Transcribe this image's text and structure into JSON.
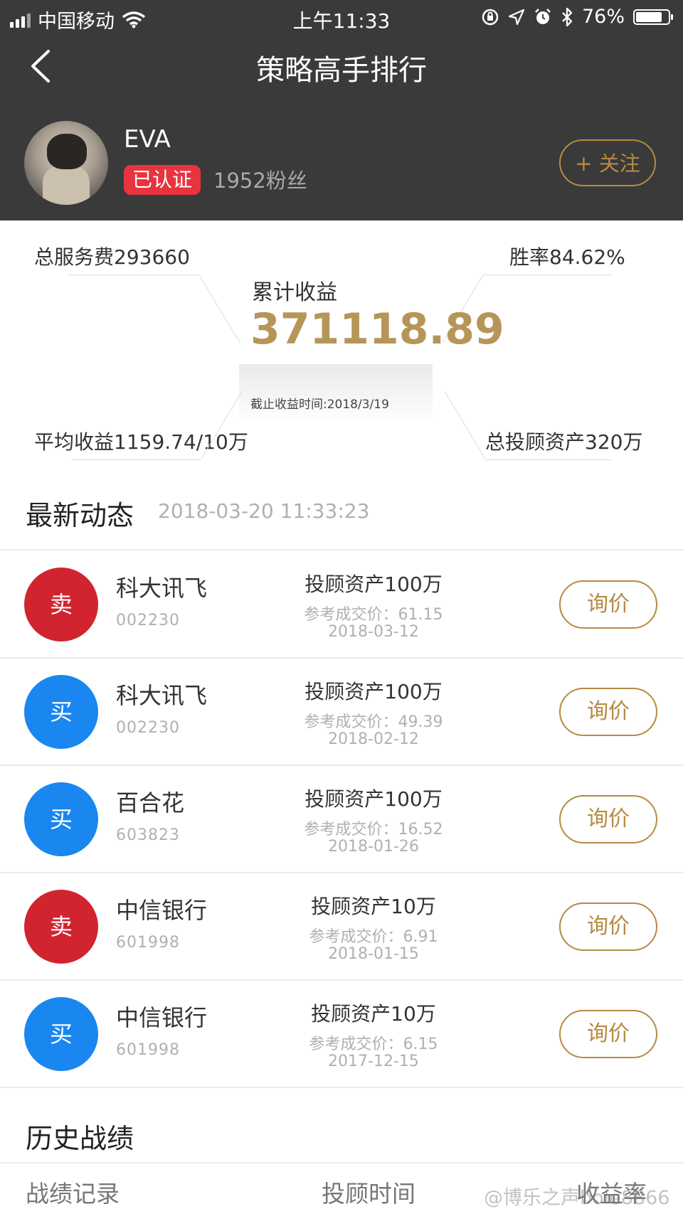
{
  "status_bar": {
    "carrier": "中国移动",
    "time": "上午11:33",
    "battery": "76%"
  },
  "nav": {
    "title": "策略高手排行"
  },
  "profile": {
    "name": "EVA",
    "verified_label": "已认证",
    "fans": "1952粉丝",
    "follow_label": "+ 关注"
  },
  "stats": {
    "total_service_fee": "总服务费293660",
    "win_rate": "胜率84.62%",
    "cumulative_label": "累计收益",
    "cumulative_value": "371118.89",
    "cutoff_time": "截止收益时间:2018/3/19",
    "avg_return": "平均收益1159.74/10万",
    "total_assets": "总投顾资产320万"
  },
  "latest": {
    "title": "最新动态",
    "timestamp": "2018-03-20 11:33:23",
    "items": [
      {
        "action": "卖",
        "color": "#d1242f",
        "name": "科大讯飞",
        "code": "002230",
        "asset": "投顾资产100万",
        "ref": "参考成交价：61.15",
        "date": "2018-03-12",
        "button": "询价"
      },
      {
        "action": "买",
        "color": "#1a86f0",
        "name": "科大讯飞",
        "code": "002230",
        "asset": "投顾资产100万",
        "ref": "参考成交价：49.39",
        "date": "2018-02-12",
        "button": "询价"
      },
      {
        "action": "买",
        "color": "#1a86f0",
        "name": "百合花",
        "code": "603823",
        "asset": "投顾资产100万",
        "ref": "参考成交价：16.52",
        "date": "2018-01-26",
        "button": "询价"
      },
      {
        "action": "卖",
        "color": "#d1242f",
        "name": "中信银行",
        "code": "601998",
        "asset": "投顾资产10万",
        "ref": "参考成交价：6.91",
        "date": "2018-01-15",
        "button": "询价"
      },
      {
        "action": "买",
        "color": "#1a86f0",
        "name": "中信银行",
        "code": "601998",
        "asset": "投顾资产10万",
        "ref": "参考成交价：6.15",
        "date": "2017-12-15",
        "button": "询价"
      }
    ]
  },
  "history": {
    "title": "历史战绩",
    "col_record": "战绩记录",
    "col_time": "投顾时间",
    "col_rate": "收益率"
  },
  "watermark": "@博乐之声bole8866"
}
